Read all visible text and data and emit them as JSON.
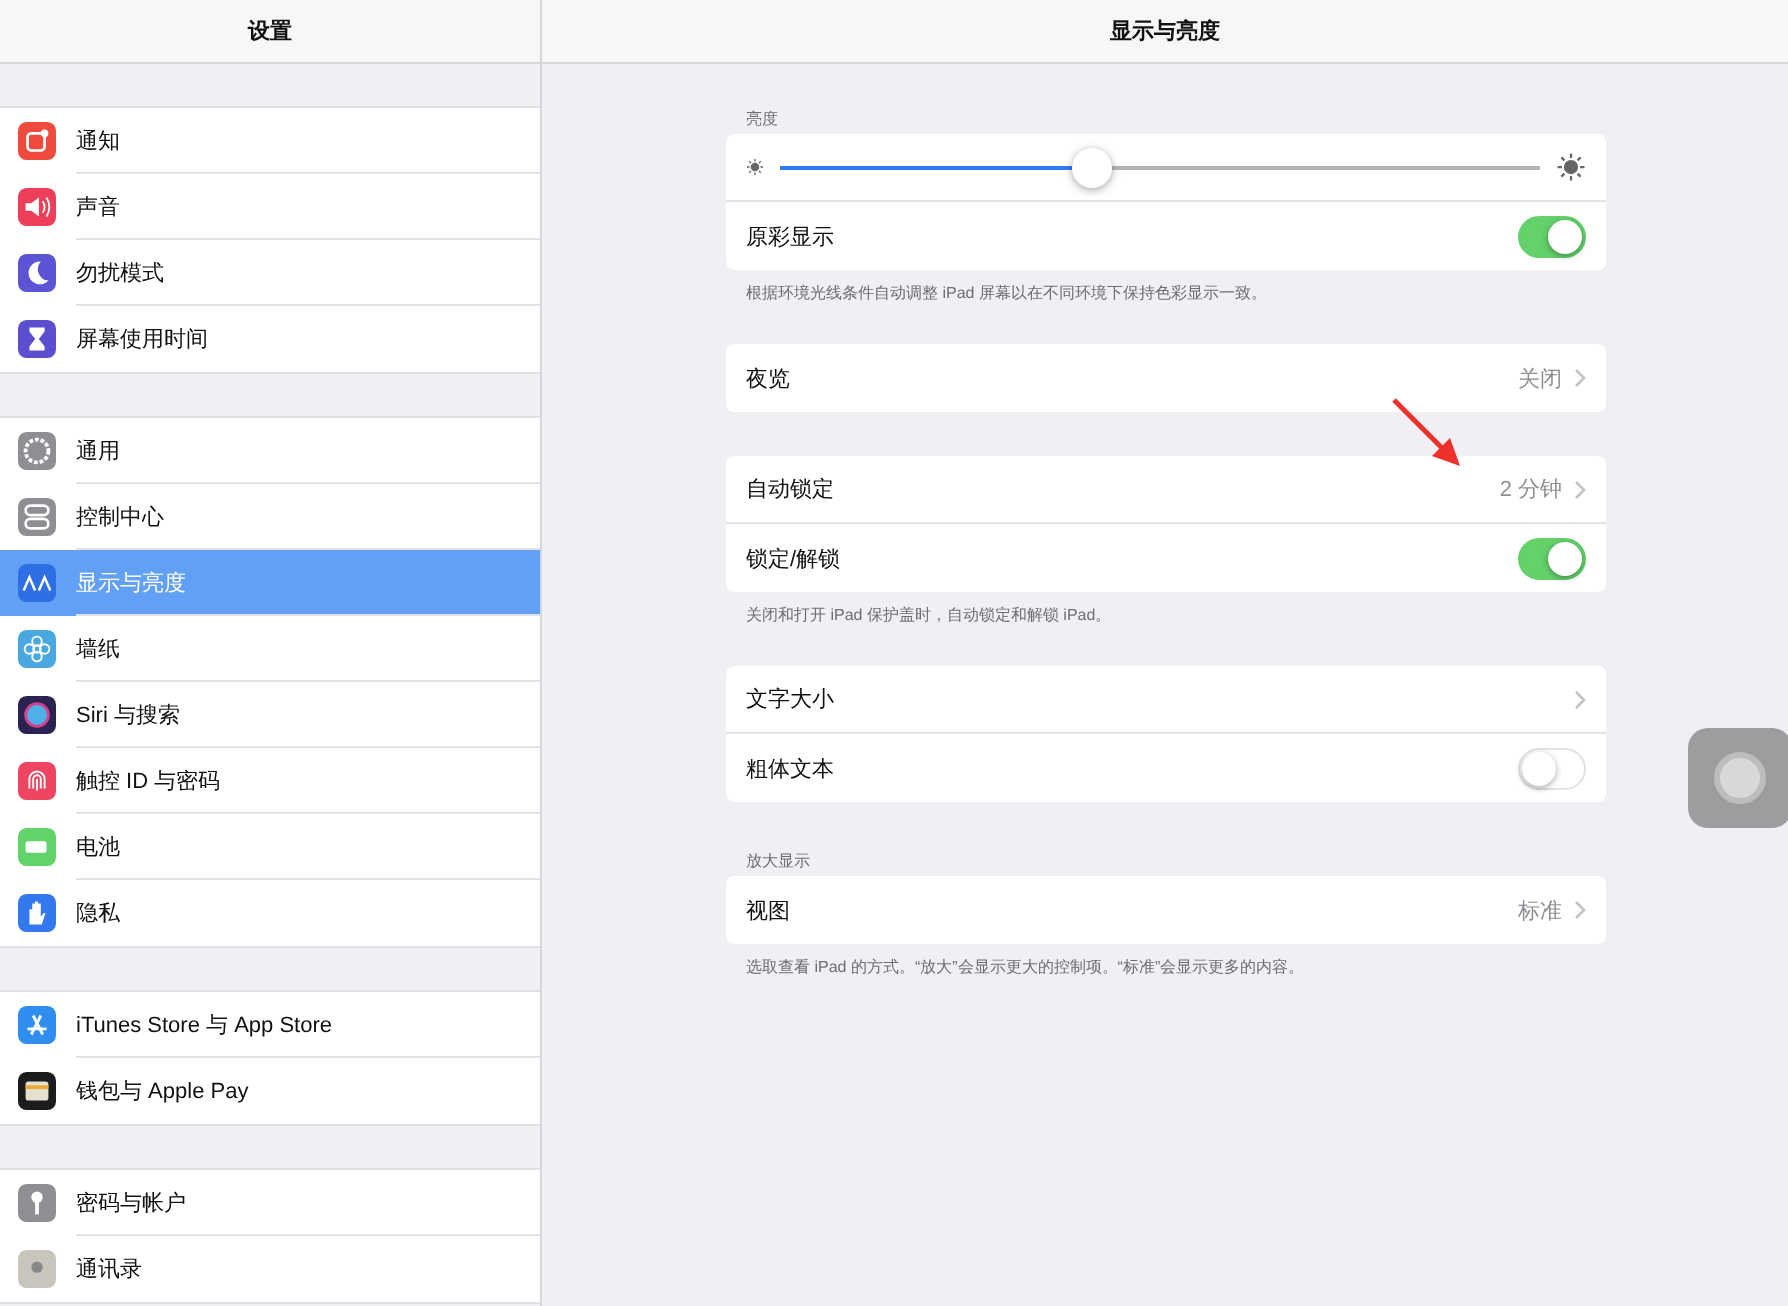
{
  "sidebar": {
    "title": "设置",
    "groups": [
      {
        "items": [
          {
            "label": "通知",
            "selected": false,
            "color": "#ee4a3d"
          },
          {
            "label": "声音",
            "selected": false,
            "color": "#ee3f5a"
          },
          {
            "label": "勿扰模式",
            "selected": false,
            "color": "#5b55d6"
          },
          {
            "label": "屏幕使用时间",
            "selected": false,
            "color": "#5b4fcf"
          }
        ]
      },
      {
        "items": [
          {
            "label": "通用",
            "selected": false,
            "color": "#8e8e93"
          },
          {
            "label": "控制中心",
            "selected": false,
            "color": "#8e8e93"
          },
          {
            "label": "显示与亮度",
            "selected": true,
            "color": "#2f6fe6"
          },
          {
            "label": "墙纸",
            "selected": false,
            "color": "#4aa8e0"
          },
          {
            "label": "Siri 与搜索",
            "selected": false,
            "color": "#2a2250"
          },
          {
            "label": "触控 ID 与密码",
            "selected": false,
            "color": "#ee4560"
          },
          {
            "label": "电池",
            "selected": false,
            "color": "#62d26a"
          },
          {
            "label": "隐私",
            "selected": false,
            "color": "#3478f0"
          }
        ]
      },
      {
        "items": [
          {
            "label": "iTunes Store 与 App Store",
            "selected": false,
            "color": "#2f8ef0"
          },
          {
            "label": "钱包与 Apple Pay",
            "selected": false,
            "color": "#1c1c1e"
          }
        ]
      },
      {
        "items": [
          {
            "label": "密码与帐户",
            "selected": false,
            "color": "#8e8e93"
          },
          {
            "label": "通讯录",
            "selected": false,
            "color": "#c9c5bd"
          }
        ]
      }
    ]
  },
  "detail": {
    "title": "显示与亮度",
    "sections": [
      {
        "header": "亮度",
        "rows": [
          {
            "kind": "slider",
            "level": 0.41
          },
          {
            "kind": "toggle",
            "label": "原彩显示",
            "on": true
          }
        ],
        "footnote": "根据环境光线条件自动调整 iPad 屏幕以在不同环境下保持色彩显示一致。"
      },
      {
        "rows": [
          {
            "kind": "link",
            "label": "夜览",
            "value": "关闭"
          }
        ]
      },
      {
        "rows": [
          {
            "kind": "link",
            "label": "自动锁定",
            "value": "2 分钟"
          },
          {
            "kind": "toggle",
            "label": "锁定/解锁",
            "on": true
          }
        ],
        "footnote": "关闭和打开 iPad 保护盖时，自动锁定和解锁 iPad。"
      },
      {
        "rows": [
          {
            "kind": "link",
            "label": "文字大小"
          },
          {
            "kind": "toggle",
            "label": "粗体文本",
            "on": false
          }
        ]
      },
      {
        "header": "放大显示",
        "rows": [
          {
            "kind": "link",
            "label": "视图",
            "value": "标准"
          }
        ],
        "footnote": "选取查看 iPad 的方式。“放大”会显示更大的控制项。“标准”会显示更多的内容。"
      }
    ]
  }
}
